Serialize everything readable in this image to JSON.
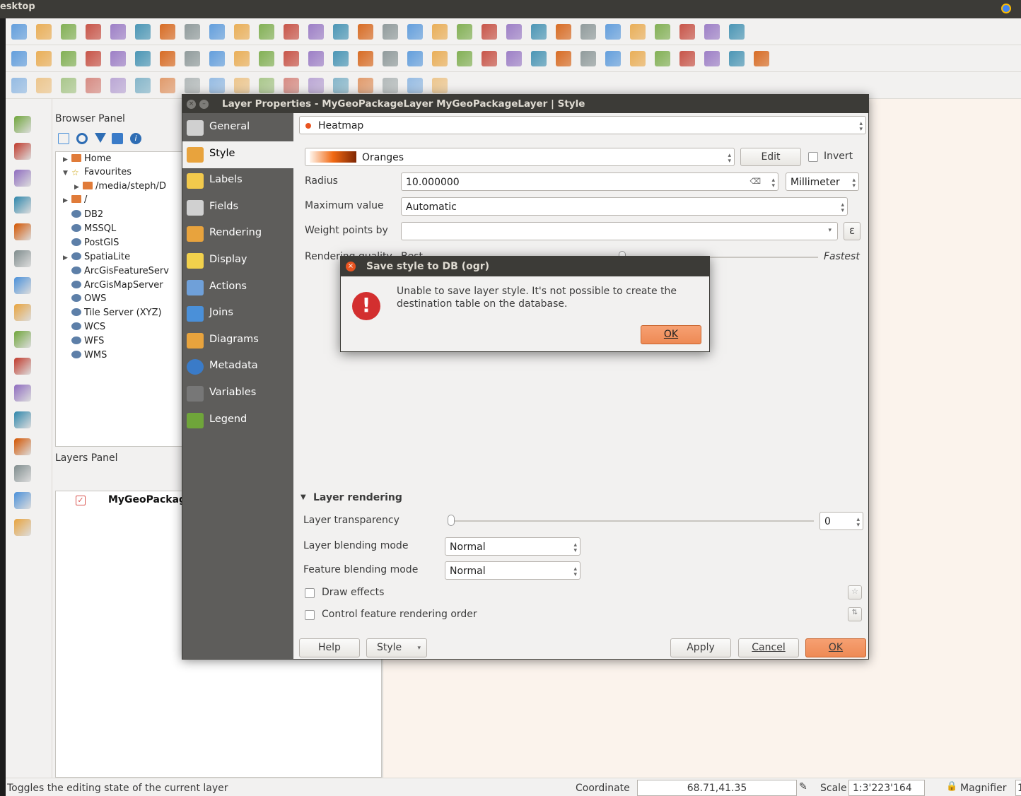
{
  "window": {
    "title": "esktop"
  },
  "browser_panel": {
    "title": "Browser Panel",
    "items": [
      {
        "label": "Home",
        "arrow": "▶"
      },
      {
        "label": "Favourites",
        "arrow": "▼"
      },
      {
        "label": "/media/steph/D",
        "arrow": "▶"
      },
      {
        "label": "/",
        "arrow": "▶"
      },
      {
        "label": "DB2",
        "arrow": ""
      },
      {
        "label": "MSSQL",
        "arrow": ""
      },
      {
        "label": "PostGIS",
        "arrow": ""
      },
      {
        "label": "SpatiaLite",
        "arrow": "▶"
      },
      {
        "label": "ArcGisFeatureServ",
        "arrow": ""
      },
      {
        "label": "ArcGisMapServer",
        "arrow": ""
      },
      {
        "label": "OWS",
        "arrow": ""
      },
      {
        "label": "Tile Server (XYZ)",
        "arrow": ""
      },
      {
        "label": "WCS",
        "arrow": ""
      },
      {
        "label": "WFS",
        "arrow": ""
      },
      {
        "label": "WMS",
        "arrow": ""
      }
    ]
  },
  "layers_panel": {
    "title": "Layers Panel",
    "layer_name": "MyGeoPackag"
  },
  "layer_properties": {
    "title": "Layer Properties - MyGeoPackageLayer MyGeoPackageLayer | Style",
    "nav": [
      {
        "label": "General",
        "icon": "general-icon"
      },
      {
        "label": "Style",
        "icon": "style-icon"
      },
      {
        "label": "Labels",
        "icon": "labels-icon"
      },
      {
        "label": "Fields",
        "icon": "fields-icon"
      },
      {
        "label": "Rendering",
        "icon": "rendering-icon"
      },
      {
        "label": "Display",
        "icon": "display-icon"
      },
      {
        "label": "Actions",
        "icon": "actions-icon"
      },
      {
        "label": "Joins",
        "icon": "joins-icon"
      },
      {
        "label": "Diagrams",
        "icon": "diagrams-icon"
      },
      {
        "label": "Metadata",
        "icon": "metadata-icon"
      },
      {
        "label": "Variables",
        "icon": "variables-icon"
      },
      {
        "label": "Legend",
        "icon": "legend-icon"
      }
    ],
    "renderer": "Heatmap",
    "color_ramp": "Oranges",
    "edit_label": "Edit",
    "invert_label": "Invert",
    "radius_label": "Radius",
    "radius_value": "10.000000",
    "radius_unit": "Millimeter",
    "max_value_label": "Maximum value",
    "max_value": "Automatic",
    "weight_label": "Weight points by",
    "weight_value": "",
    "quality_label": "Rendering quality",
    "quality_best": "Best",
    "quality_fastest": "Fastest",
    "layer_rendering_label": "Layer rendering",
    "transparency_label": "Layer transparency",
    "transparency_value": "0",
    "blending_label": "Layer blending mode",
    "blending_value": "Normal",
    "feature_blending_label": "Feature blending mode",
    "feature_blending_value": "Normal",
    "draw_effects_label": "Draw effects",
    "control_order_label": "Control feature rendering order",
    "help_label": "Help",
    "style_label": "Style",
    "apply_label": "Apply",
    "cancel_label": "Cancel",
    "ok_label": "OK"
  },
  "error_dialog": {
    "title": "Save style to DB (ogr)",
    "message": "Unable to save layer style. It's not possible to create the destination table on the database.",
    "ok_label": "OK"
  },
  "status_bar": {
    "message": "Toggles the editing state of the current layer",
    "coordinate_label": "Coordinate",
    "coordinate_value": "68.71,41.35",
    "scale_label": "Scale",
    "scale_value": "1:3'223'164",
    "magnifier_label": "Magnifier",
    "magnifier_value": "1"
  },
  "colors": {
    "accent": "#e95420",
    "ok_button": "#ee8a55",
    "title_bar": "#3c3b37",
    "nav_bg": "#5e5d5b",
    "map_bg": "#fbf3ec"
  }
}
